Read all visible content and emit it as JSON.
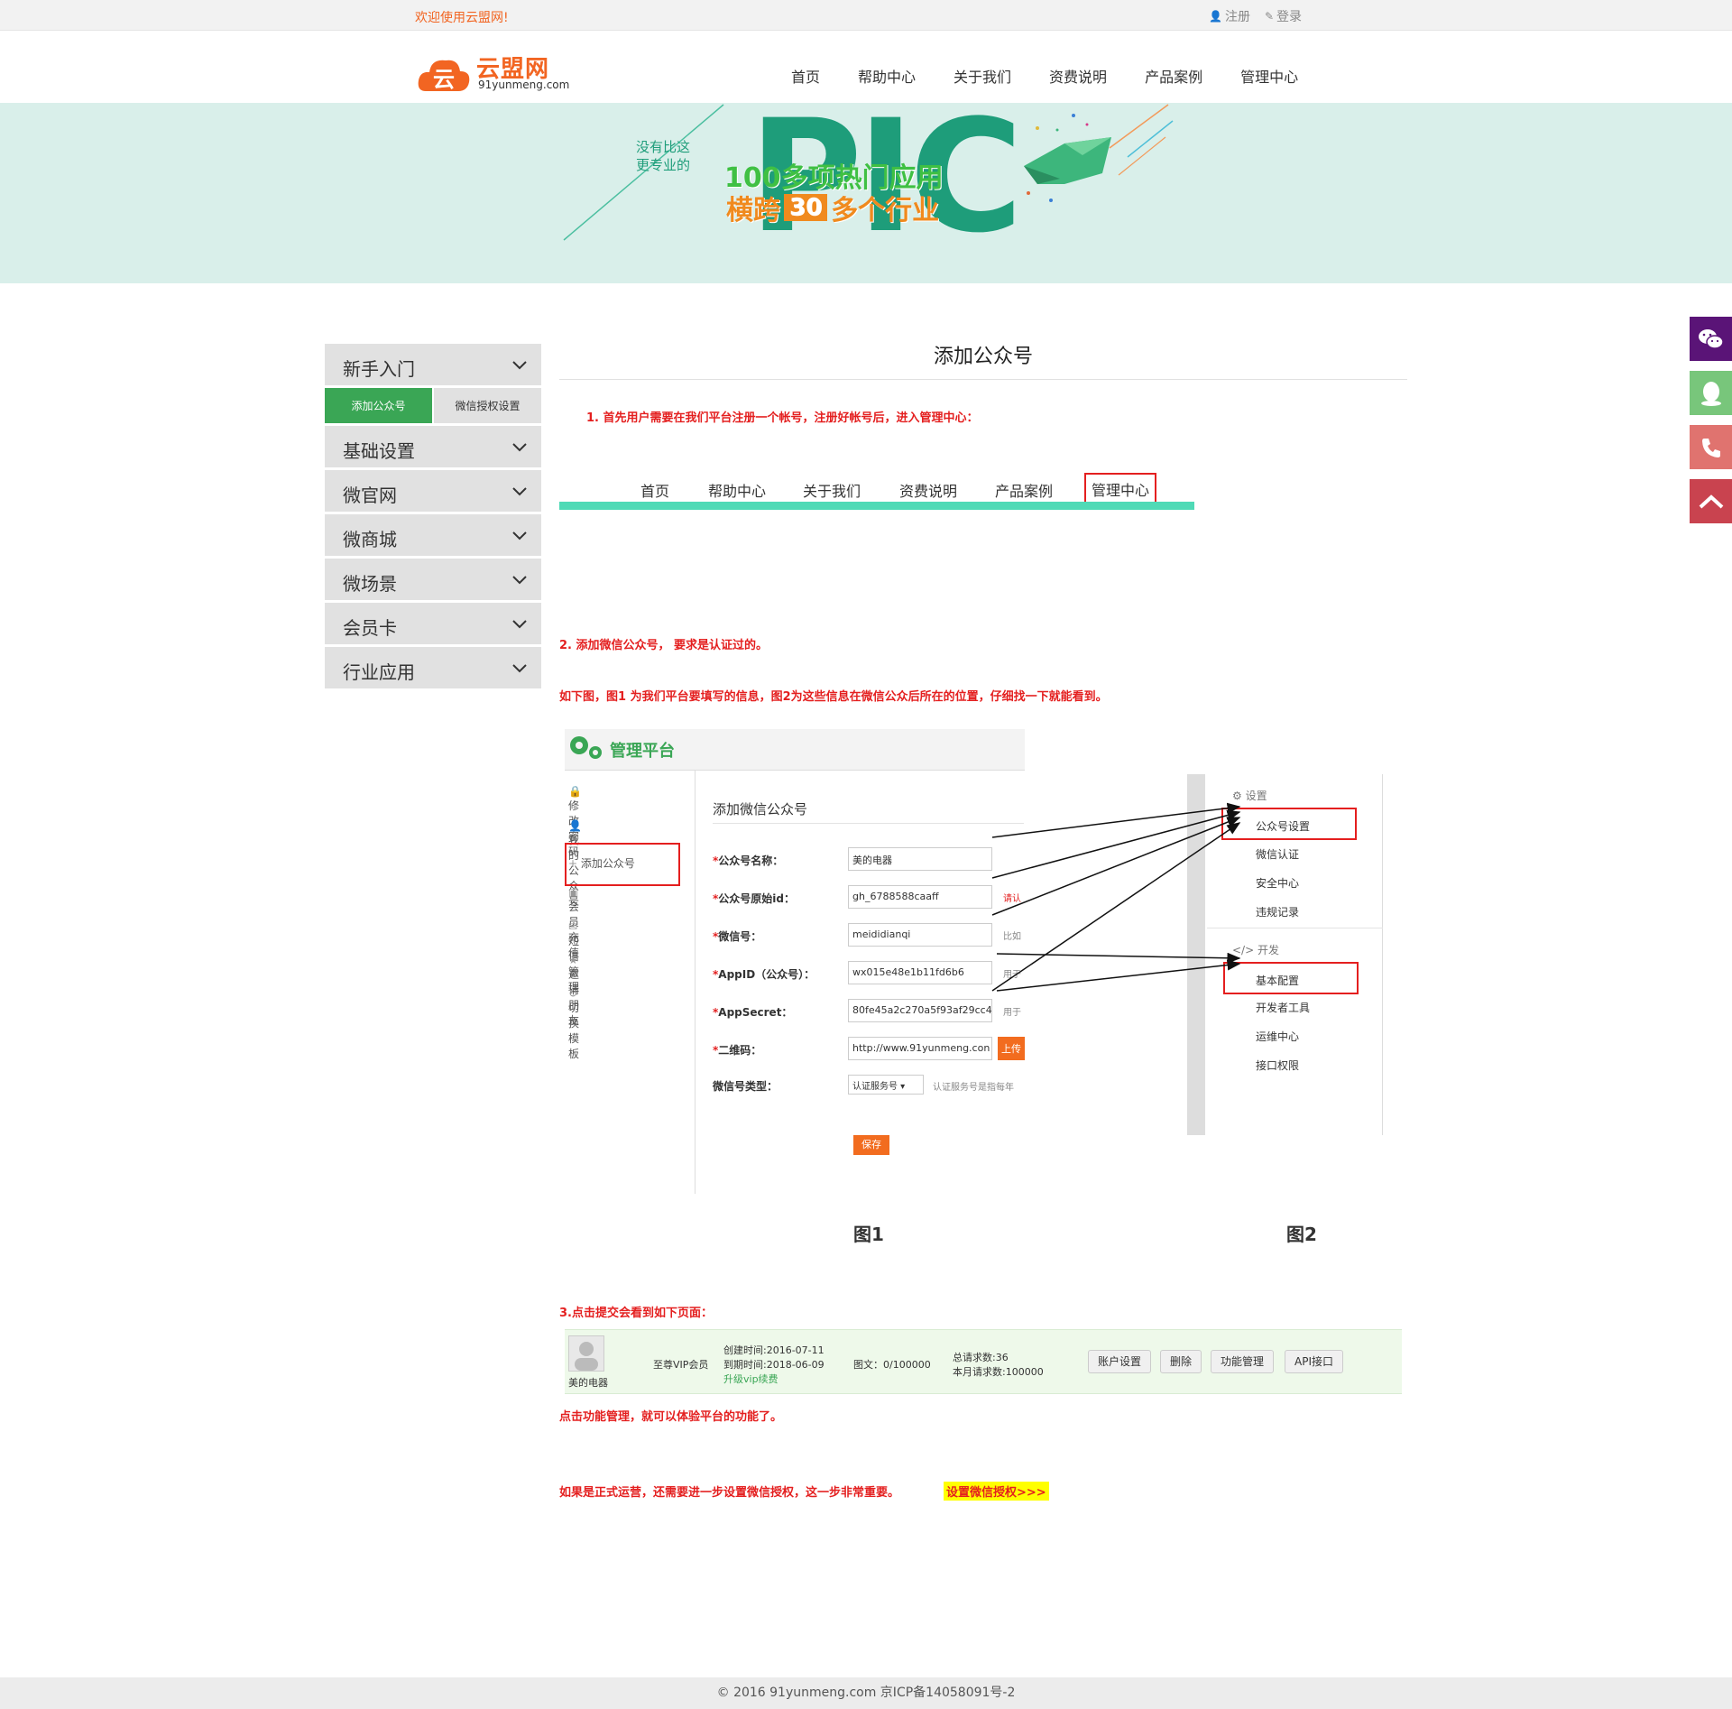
{
  "topbar": {
    "welcome": "欢迎使用云盟网!",
    "register": "注册",
    "login": "登录"
  },
  "logo": {
    "name": "云盟网",
    "domain": "91yunmeng.com",
    "glyph": "云"
  },
  "nav": [
    "首页",
    "帮助中心",
    "关于我们",
    "资费说明",
    "产品案例",
    "管理中心"
  ],
  "banner": {
    "tag1": "没有比这",
    "tag2": "更专业的",
    "big": "PIC",
    "line1": "100多项热门应用",
    "line2a": "横跨",
    "line2num": "30",
    "line2b": "多个行业"
  },
  "sidebar": {
    "sections": [
      "新手入门",
      "基础设置",
      "微官网",
      "微商城",
      "微场景",
      "会员卡",
      "行业应用"
    ],
    "subtabs": [
      "添加公众号",
      "微信授权设置"
    ]
  },
  "main": {
    "title": "添加公众号",
    "step1": "1. 首先用户需要在我们平台注册一个帐号，注册好帐号后，进入管理中心：",
    "step2": "2. 添加微信公众号，  要求是认证过的。",
    "step2b": "如下图，图1 为我们平台要填写的信息，图2为这些信息在微信公众后所在的位置，仔细找一下就能看到。",
    "step3": "3.点击提交会看到如下页面：",
    "step3b": "点击功能管理，就可以体验平台的功能了。",
    "final": "如果是正式运营，还需要进一步设置微信授权，这一步非常重要。",
    "finalLink": "设置微信授权>>>",
    "fig1cap": "图1",
    "fig2cap": "图2"
  },
  "fignav": [
    "首页",
    "帮助中心",
    "关于我们",
    "资费说明",
    "产品案例",
    "管理中心"
  ],
  "fig1": {
    "header": "管理平台",
    "menu": [
      "修改密码",
      "我的公众号",
      "添加公众号",
      "会员充值",
      "短信管理",
      "邀请朋友",
      "切换模板"
    ],
    "formTitle": "添加微信公众号",
    "fields": [
      {
        "label": "公众号名称：",
        "value": "美的电器",
        "note": ""
      },
      {
        "label": "公众号原始id：",
        "value": "gh_6788588caaff",
        "note": "请认"
      },
      {
        "label": "微信号：",
        "value": "meididianqi",
        "note": "比如"
      },
      {
        "label": "AppID（公众号）：",
        "value": "wx015e48e1b11fd6b6",
        "note": "用于"
      },
      {
        "label": "AppSecret：",
        "value": "80fe45a2c270a5f93af29cc4f",
        "note": "用于"
      },
      {
        "label": "二维码：",
        "value": "http://www.91yunmeng.con",
        "note": "上传"
      }
    ],
    "typeLabel": "微信号类型：",
    "typeValue": "认证服务号",
    "typeNote": "认证服务号是指每年",
    "save": "保存"
  },
  "fig2": {
    "group1": "设置",
    "items1": [
      "公众号设置",
      "微信认证",
      "安全中心",
      "违规记录"
    ],
    "group2": "开发",
    "items2": [
      "基本配置",
      "开发者工具",
      "运维中心",
      "接口权限"
    ]
  },
  "result": {
    "name": "美的电器",
    "level": "至尊VIP会员",
    "created": "创建时间:2016-07-11",
    "expires": "到期时间:2018-06-09",
    "upgrade": "升级vip续费",
    "posts": "图文：0/100000",
    "total": "总请求数:36",
    "month": "本月请求数:100000",
    "buttons": [
      "账户设置",
      "删除",
      "功能管理",
      "API接口"
    ]
  },
  "footer": "© 2016 91yunmeng.com 京ICP备14058091号-2",
  "colors": {
    "orange": "#f26522",
    "green": "#3aa655",
    "teal": "#4fdab6",
    "red": "#e41f1f"
  }
}
